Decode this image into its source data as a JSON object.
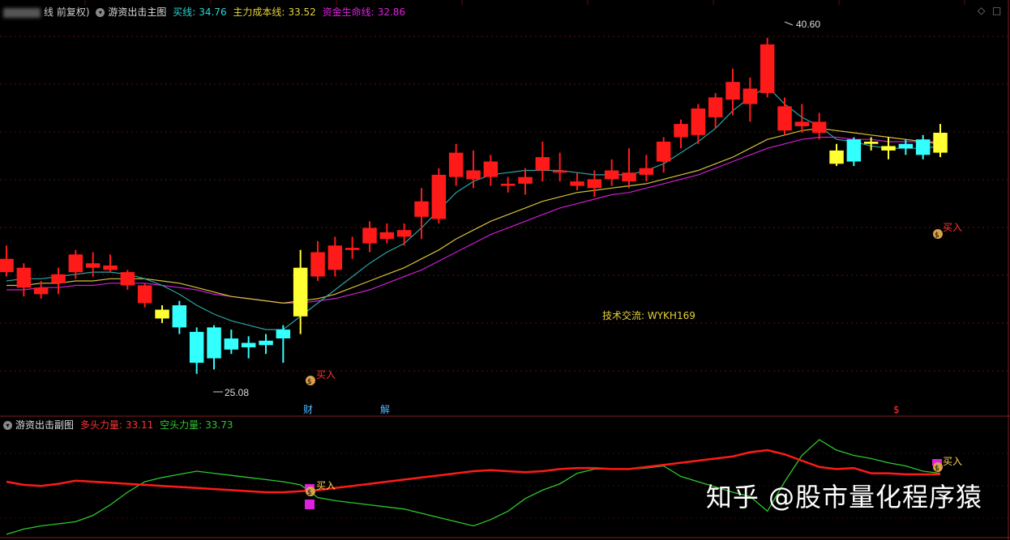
{
  "main_header": {
    "period_label": "线 前复权)",
    "indicator_name": "游资出击主图",
    "buy_line_label": "买线:",
    "buy_line_value": "34.76",
    "cost_line_label": "主力成本线:",
    "cost_line_value": "33.52",
    "life_line_label": "资金生命线:",
    "life_line_value": "32.86"
  },
  "sub_header": {
    "indicator_name": "游资出击副图",
    "long_label": "多头力量:",
    "long_value": "33.11",
    "short_label": "空头力量:",
    "short_value": "33.73"
  },
  "annotations": {
    "high_label": "40.60",
    "low_label": "25.08",
    "buy_signal": "买入",
    "tech_label": "技术交流: WYKH169",
    "cai_marker": "财",
    "jie_marker": "解",
    "dollar_marker": "$"
  },
  "watermark": "知乎 @股市量化程序猿",
  "colors": {
    "up": "#ff1a1a",
    "down": "#33ffff",
    "buy_candle": "#ffff33",
    "buy_line": "#2aa6a6",
    "cost_line": "#d6c23a",
    "life_line": "#d21cd2",
    "long_force": "#ff1a1a",
    "short_force": "#2ec82e"
  },
  "chart_data": [
    {
      "type": "candlestick",
      "ylim": [
        24,
        41.5
      ],
      "high_mark": 40.6,
      "low_mark": 25.08,
      "candles": [
        {
          "o": 30.6,
          "h": 31.2,
          "l": 29.8,
          "c": 30.0,
          "k": "up"
        },
        {
          "o": 30.2,
          "h": 30.4,
          "l": 28.9,
          "c": 29.3,
          "k": "up"
        },
        {
          "o": 29.3,
          "h": 29.6,
          "l": 28.8,
          "c": 29.0,
          "k": "up"
        },
        {
          "o": 29.5,
          "h": 30.2,
          "l": 29.0,
          "c": 29.9,
          "k": "up"
        },
        {
          "o": 30.0,
          "h": 31.0,
          "l": 29.7,
          "c": 30.8,
          "k": "up"
        },
        {
          "o": 30.2,
          "h": 30.9,
          "l": 29.8,
          "c": 30.4,
          "k": "up"
        },
        {
          "o": 30.3,
          "h": 30.8,
          "l": 30.0,
          "c": 30.1,
          "k": "up"
        },
        {
          "o": 30.0,
          "h": 30.1,
          "l": 29.2,
          "c": 29.4,
          "k": "up"
        },
        {
          "o": 29.4,
          "h": 29.5,
          "l": 28.4,
          "c": 28.6,
          "k": "up"
        },
        {
          "o": 28.3,
          "h": 28.5,
          "l": 27.7,
          "c": 27.9,
          "k": "buy"
        },
        {
          "o": 28.5,
          "h": 28.7,
          "l": 27.2,
          "c": 27.5,
          "k": "down"
        },
        {
          "o": 27.3,
          "h": 27.5,
          "l": 25.4,
          "c": 25.9,
          "k": "down"
        },
        {
          "o": 26.1,
          "h": 27.6,
          "l": 25.6,
          "c": 27.5,
          "k": "down"
        },
        {
          "o": 27.0,
          "h": 27.4,
          "l": 26.3,
          "c": 26.5,
          "k": "down"
        },
        {
          "o": 26.6,
          "h": 27.1,
          "l": 26.1,
          "c": 26.8,
          "k": "down"
        },
        {
          "o": 26.7,
          "h": 27.2,
          "l": 26.3,
          "c": 26.9,
          "k": "down"
        },
        {
          "o": 27.0,
          "h": 27.6,
          "l": 25.9,
          "c": 27.4,
          "k": "down"
        },
        {
          "o": 28.0,
          "h": 31.0,
          "l": 27.2,
          "c": 30.2,
          "k": "buy"
        },
        {
          "o": 29.8,
          "h": 31.4,
          "l": 29.6,
          "c": 30.9,
          "k": "up"
        },
        {
          "o": 30.1,
          "h": 31.6,
          "l": 29.8,
          "c": 31.2,
          "k": "up"
        },
        {
          "o": 31.0,
          "h": 31.6,
          "l": 30.6,
          "c": 31.1,
          "k": "up"
        },
        {
          "o": 31.3,
          "h": 32.3,
          "l": 30.9,
          "c": 32.0,
          "k": "up"
        },
        {
          "o": 31.5,
          "h": 32.2,
          "l": 31.3,
          "c": 31.8,
          "k": "up"
        },
        {
          "o": 31.6,
          "h": 32.2,
          "l": 31.2,
          "c": 31.9,
          "k": "up"
        },
        {
          "o": 32.5,
          "h": 33.8,
          "l": 31.5,
          "c": 33.2,
          "k": "up"
        },
        {
          "o": 32.4,
          "h": 34.7,
          "l": 32.2,
          "c": 34.4,
          "k": "up"
        },
        {
          "o": 34.3,
          "h": 35.8,
          "l": 33.9,
          "c": 35.4,
          "k": "up"
        },
        {
          "o": 34.2,
          "h": 35.5,
          "l": 33.8,
          "c": 34.6,
          "k": "up"
        },
        {
          "o": 34.3,
          "h": 35.3,
          "l": 33.9,
          "c": 35.0,
          "k": "up"
        },
        {
          "o": 34.0,
          "h": 34.3,
          "l": 33.6,
          "c": 33.9,
          "k": "up"
        },
        {
          "o": 34.3,
          "h": 34.7,
          "l": 33.5,
          "c": 34.0,
          "k": "up"
        },
        {
          "o": 34.6,
          "h": 35.9,
          "l": 34.1,
          "c": 35.2,
          "k": "up"
        },
        {
          "o": 34.5,
          "h": 35.4,
          "l": 34.1,
          "c": 34.6,
          "k": "up"
        },
        {
          "o": 34.1,
          "h": 34.5,
          "l": 33.7,
          "c": 33.9,
          "k": "up"
        },
        {
          "o": 33.8,
          "h": 34.6,
          "l": 33.4,
          "c": 34.2,
          "k": "up"
        },
        {
          "o": 34.2,
          "h": 35.1,
          "l": 33.9,
          "c": 34.6,
          "k": "up"
        },
        {
          "o": 34.1,
          "h": 35.6,
          "l": 33.8,
          "c": 34.5,
          "k": "up"
        },
        {
          "o": 34.7,
          "h": 35.3,
          "l": 34.1,
          "c": 34.4,
          "k": "up"
        },
        {
          "o": 35.0,
          "h": 36.1,
          "l": 34.5,
          "c": 35.9,
          "k": "up"
        },
        {
          "o": 36.1,
          "h": 36.9,
          "l": 35.6,
          "c": 36.7,
          "k": "up"
        },
        {
          "o": 36.2,
          "h": 37.6,
          "l": 35.8,
          "c": 37.4,
          "k": "up"
        },
        {
          "o": 37.0,
          "h": 38.1,
          "l": 36.5,
          "c": 37.9,
          "k": "up"
        },
        {
          "o": 37.8,
          "h": 39.2,
          "l": 37.1,
          "c": 38.6,
          "k": "up"
        },
        {
          "o": 37.6,
          "h": 38.8,
          "l": 36.8,
          "c": 38.3,
          "k": "up"
        },
        {
          "o": 38.1,
          "h": 40.6,
          "l": 37.9,
          "c": 40.3,
          "k": "up"
        },
        {
          "o": 37.5,
          "h": 37.9,
          "l": 36.2,
          "c": 36.4,
          "k": "up"
        },
        {
          "o": 36.8,
          "h": 37.6,
          "l": 36.3,
          "c": 36.6,
          "k": "up"
        },
        {
          "o": 36.8,
          "h": 37.2,
          "l": 36.0,
          "c": 36.3,
          "k": "up"
        },
        {
          "o": 35.5,
          "h": 35.8,
          "l": 34.8,
          "c": 34.9,
          "k": "buy"
        },
        {
          "o": 35.0,
          "h": 36.1,
          "l": 34.8,
          "c": 36.0,
          "k": "down"
        },
        {
          "o": 35.8,
          "h": 36.1,
          "l": 35.5,
          "c": 35.9,
          "k": "buy"
        },
        {
          "o": 35.7,
          "h": 36.1,
          "l": 35.1,
          "c": 35.5,
          "k": "buy"
        },
        {
          "o": 35.8,
          "h": 36.0,
          "l": 35.3,
          "c": 35.6,
          "k": "down"
        },
        {
          "o": 35.3,
          "h": 36.2,
          "l": 35.1,
          "c": 36.0,
          "k": "down"
        },
        {
          "o": 35.4,
          "h": 36.7,
          "l": 35.2,
          "c": 36.3,
          "k": "buy"
        }
      ],
      "buy_line": [
        29.6,
        29.7,
        29.7,
        29.8,
        29.9,
        30.0,
        30.0,
        29.9,
        29.7,
        29.4,
        29.0,
        28.5,
        28.1,
        27.8,
        27.6,
        27.4,
        27.4,
        28.0,
        28.6,
        29.2,
        29.8,
        30.4,
        30.9,
        31.3,
        32.0,
        32.8,
        33.6,
        34.1,
        34.4,
        34.5,
        34.6,
        34.6,
        34.6,
        34.5,
        34.4,
        34.4,
        34.4,
        34.6,
        34.9,
        35.4,
        35.9,
        36.5,
        37.3,
        37.9,
        38.4,
        37.6,
        37.0,
        36.6,
        36.0,
        35.9,
        35.7,
        35.6,
        35.6,
        35.6,
        35.7
      ],
      "cost_line": [
        29.4,
        29.4,
        29.5,
        29.5,
        29.6,
        29.6,
        29.7,
        29.7,
        29.7,
        29.6,
        29.5,
        29.3,
        29.1,
        28.9,
        28.8,
        28.7,
        28.6,
        28.7,
        28.8,
        29.0,
        29.3,
        29.6,
        29.9,
        30.2,
        30.6,
        31.0,
        31.5,
        31.9,
        32.3,
        32.6,
        32.9,
        33.2,
        33.4,
        33.6,
        33.7,
        33.8,
        33.9,
        34.0,
        34.2,
        34.4,
        34.6,
        34.9,
        35.2,
        35.6,
        36.0,
        36.2,
        36.4,
        36.5,
        36.4,
        36.3,
        36.2,
        36.1,
        36.0,
        35.9,
        35.8
      ],
      "life_line": [
        29.2,
        29.2,
        29.3,
        29.3,
        29.4,
        29.4,
        29.5,
        29.5,
        29.5,
        29.4,
        29.3,
        29.2,
        29.0,
        28.9,
        28.8,
        28.7,
        28.6,
        28.6,
        28.7,
        28.8,
        29.0,
        29.2,
        29.5,
        29.8,
        30.1,
        30.5,
        30.9,
        31.3,
        31.7,
        32.0,
        32.3,
        32.6,
        32.9,
        33.1,
        33.3,
        33.5,
        33.6,
        33.8,
        34.0,
        34.2,
        34.4,
        34.7,
        35.0,
        35.3,
        35.6,
        35.8,
        36.0,
        36.1,
        36.1,
        36.0,
        36.0,
        35.9,
        35.9,
        35.9,
        35.9
      ]
    },
    {
      "type": "line",
      "ylim": [
        0,
        100
      ],
      "series": [
        {
          "name": "多头力量",
          "values": [
            50,
            47,
            46,
            48,
            51,
            50,
            49,
            48,
            47,
            46,
            45,
            44,
            43,
            42,
            41,
            40,
            40,
            41,
            42,
            44,
            46,
            48,
            50,
            52,
            54,
            56,
            58,
            60,
            61,
            60,
            59,
            60,
            62,
            63,
            63,
            62,
            62,
            64,
            66,
            68,
            70,
            72,
            74,
            78,
            80,
            76,
            70,
            64,
            62,
            63,
            58,
            58,
            57,
            57,
            57
          ]
        },
        {
          "name": "空头力量",
          "values": [
            0,
            5,
            8,
            10,
            12,
            18,
            28,
            40,
            50,
            54,
            57,
            60,
            58,
            56,
            54,
            52,
            50,
            47,
            35,
            32,
            30,
            28,
            26,
            24,
            20,
            16,
            12,
            8,
            14,
            22,
            34,
            42,
            48,
            58,
            62,
            62,
            62,
            63,
            65,
            55,
            50,
            45,
            40,
            36,
            22,
            50,
            75,
            90,
            80,
            75,
            72,
            68,
            65,
            60,
            58
          ]
        }
      ]
    }
  ]
}
